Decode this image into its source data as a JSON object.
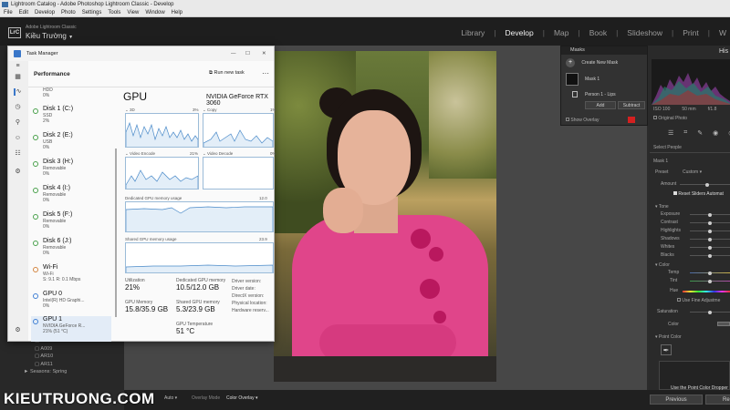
{
  "window": {
    "title": "Lightroom Catalog - Adobe Photoshop Lightroom Classic - Develop"
  },
  "menu": [
    "File",
    "Edit",
    "Develop",
    "Photo",
    "Settings",
    "Tools",
    "View",
    "Window",
    "Help"
  ],
  "lr": {
    "logo": "LrC",
    "app_name": "Adobe Lightroom Classic",
    "user": "Kiều Trường",
    "modules": [
      {
        "label": "Library",
        "active": false
      },
      {
        "label": "Develop",
        "active": true
      },
      {
        "label": "Map",
        "active": false
      },
      {
        "label": "Book",
        "active": false
      },
      {
        "label": "Slideshow",
        "active": false
      },
      {
        "label": "Print",
        "active": false
      },
      {
        "label": "W",
        "active": false
      }
    ],
    "left_list": [
      "A006",
      "A009",
      "AR10",
      "AR11",
      "Seasons: Spring"
    ]
  },
  "masks": {
    "title": "Masks",
    "create_label": "Create New Mask",
    "mask1": "Mask 1",
    "person": "Person 1 - Lips",
    "add": "Add",
    "subtract": "Subtract",
    "show_overlay": "Show Overlay",
    "overlay_color": "#d42020"
  },
  "right_panel": {
    "histogram": "His",
    "original_photo": "Original Photo",
    "select_people": "Select People",
    "mask1": "Mask 1",
    "preset_label": "Preset",
    "preset_value": "Custom",
    "amount": "Amount",
    "reset_label": "Reset Sliders Automat",
    "tone": "Tone",
    "tone_items": [
      "Exposure",
      "Contrast",
      "Highlights",
      "Shadows",
      "Whites",
      "Blacks"
    ],
    "color": "Color",
    "color_items": [
      "Temp",
      "Tint",
      "Hue"
    ],
    "fine_adjust": "Use Fine Adjustme",
    "saturation": "Saturation",
    "color_label": "Color",
    "point_color": "Point Color",
    "point_color_hint": "Use the Point Color Dropper",
    "iso_values": [
      "ISO 100",
      "50 mm",
      "f/1.8"
    ],
    "previous": "Previous",
    "reset": "Re"
  },
  "bottom": {
    "auto": "Auto",
    "overlay_mode": "Overlay Mode",
    "overlay_value": "Color Overlay"
  },
  "watermark": "KIEUTRUONG.COM",
  "taskmanager": {
    "title": "Task Manager",
    "section": "Performance",
    "run_new_task": "Run new task",
    "more": "···",
    "devices": [
      {
        "name": "HDD",
        "line2": "0%",
        "line3": "",
        "dot": "green",
        "partial": true
      },
      {
        "name": "Disk 1 (C:)",
        "line2": "SSD",
        "line3": "2%",
        "dot": "green"
      },
      {
        "name": "Disk 2 (E:)",
        "line2": "USB",
        "line3": "0%",
        "dot": "green"
      },
      {
        "name": "Disk 3 (H:)",
        "line2": "Removable",
        "line3": "0%",
        "dot": "green"
      },
      {
        "name": "Disk 4 (I:)",
        "line2": "Removable",
        "line3": "0%",
        "dot": "green"
      },
      {
        "name": "Disk 5 (F:)",
        "line2": "Removable",
        "line3": "0%",
        "dot": "green"
      },
      {
        "name": "Disk 6 (J:)",
        "line2": "Removable",
        "line3": "0%",
        "dot": "green"
      },
      {
        "name": "Wi-Fi",
        "line2": "Wi-Fi",
        "line3": "S: 9.1 R: 0.1 Mbps",
        "dot": "orange"
      },
      {
        "name": "GPU 0",
        "line2": "Intel(R) HD Graphi...",
        "line3": "0%",
        "dot": "blue"
      },
      {
        "name": "GPU 1",
        "line2": "NVIDIA GeForce R...",
        "line3": "21% (51 °C)",
        "dot": "blue",
        "selected": true
      }
    ],
    "gpu": {
      "heading": "GPU",
      "model": "NVIDIA GeForce RTX 3060",
      "graphs": [
        {
          "label": "3D",
          "pct": "3%"
        },
        {
          "label": "Copy",
          "pct": "1%"
        },
        {
          "label": "Video Encode",
          "pct": "21%"
        },
        {
          "label": "Video Decode",
          "pct": "0%"
        }
      ],
      "dedicated_label": "Dedicated GPU memory usage",
      "dedicated_max": "12.0 GB",
      "shared_label": "Shared GPU memory usage",
      "shared_max": "23.9 GB",
      "stats": {
        "utilization_label": "Utilization",
        "utilization": "21%",
        "dedicated_mem_label": "Dedicated GPU memory",
        "dedicated_mem": "10.5/12.0 GB",
        "gpu_mem_label": "GPU Memory",
        "gpu_mem": "15.8/35.9 GB",
        "shared_mem_label": "Shared GPU memory",
        "shared_mem": "5.3/23.9 GB",
        "temp_label": "GPU Temperature",
        "temp": "51 °C",
        "driver_labels": [
          "Driver version:",
          "Driver date:",
          "DirectX version:",
          "Physical location:",
          "Hardware reserv..."
        ]
      }
    }
  }
}
